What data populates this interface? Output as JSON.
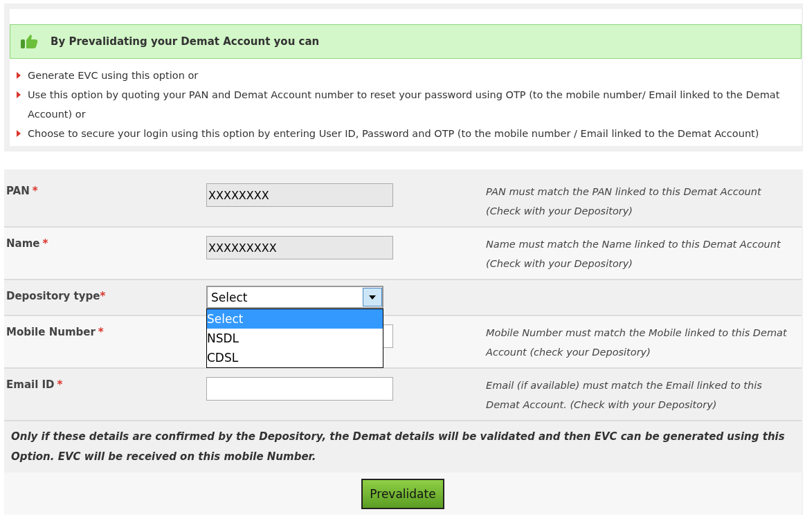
{
  "info_box": {
    "heading": "By Prevalidating your Demat Account you can",
    "points": [
      "Generate EVC using this option or",
      "Use this option by quoting your PAN and Demat Account number to reset your password using OTP (to the mobile number/ Email linked to the Demat Account) or",
      "Choose to secure your login using this option by entering User ID, Password and OTP (to the mobile number / Email linked to the Demat Account)"
    ]
  },
  "form": {
    "rows": [
      {
        "kind": "text",
        "label": "PAN",
        "required_mark": "*",
        "value": "XXXXXXXX",
        "disabled": true,
        "hint": "PAN must match the PAN linked to this Demat Account (Check with your Depository)"
      },
      {
        "kind": "text",
        "label": "Name",
        "required_mark": "*",
        "value": "XXXXXXXXX",
        "disabled": true,
        "hint": "Name must match the Name linked to this Demat Account (Check with your Depository)"
      },
      {
        "kind": "select",
        "label": "Depository type",
        "required_mark": "*",
        "value": "Select",
        "expanded": true,
        "options": [
          {
            "label": "Select",
            "selected": true
          },
          {
            "label": "NSDL",
            "selected": false
          },
          {
            "label": "CDSL",
            "selected": false
          }
        ]
      },
      {
        "kind": "text",
        "label": "Mobile Number",
        "required_mark": "*",
        "disabled": false,
        "hint": "Mobile Number must match the Mobile linked to this Demat Account (check your Depository)"
      },
      {
        "kind": "text",
        "label": "Email ID",
        "required_mark": "*",
        "disabled": false,
        "hint": "Email (if available) must match the Email linked to this Demat Account. (Check with your Depository)"
      }
    ],
    "note": "Only if these details are confirmed by the Depository, the Demat details will be validated and then EVC can be generated using this Option. EVC will be received on this mobile Number.",
    "submit_button": "Prevalidate"
  }
}
